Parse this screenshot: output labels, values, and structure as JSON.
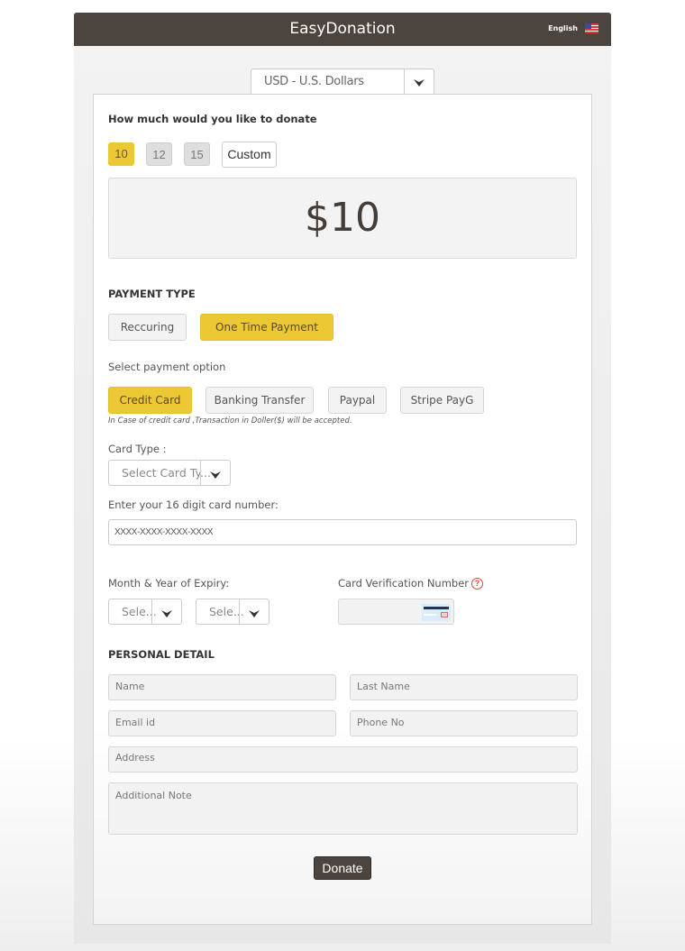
{
  "header": {
    "title": "EasyDonation",
    "language": "English",
    "flag_icon": "us-flag-icon"
  },
  "currency": {
    "selected": "USD - U.S. Dollars"
  },
  "donation": {
    "question": "How much would you like to donate",
    "amounts": [
      {
        "label": "10",
        "selected": true
      },
      {
        "label": "12",
        "selected": false
      },
      {
        "label": "15",
        "selected": false
      }
    ],
    "custom_label": "Custom",
    "display_amount": "$10"
  },
  "payment_type": {
    "heading": "PAYMENT TYPE",
    "options": [
      {
        "label": "Reccuring",
        "selected": false
      },
      {
        "label": "One Time Payment",
        "selected": true
      }
    ]
  },
  "payment_option": {
    "label": "Select payment option",
    "options": [
      {
        "label": "Credit Card",
        "selected": true
      },
      {
        "label": "Banking Transfer",
        "selected": false
      },
      {
        "label": "Paypal",
        "selected": false
      },
      {
        "label": "Stripe PayG",
        "selected": false
      }
    ],
    "note": "In Case of credit card ,Transaction in Doller($) will be accepted."
  },
  "card": {
    "type_label": "Card Type :",
    "type_placeholder": "Select Card Ty...",
    "number_label": "Enter your 16 digit card number:",
    "number_placeholder": "XXXX-XXXX-XXXX-XXXX",
    "expiry_label": "Month & Year of Expiry:",
    "month_placeholder": "Sele...",
    "year_placeholder": "Sele...",
    "cvv_label": "Card Verification Number",
    "cvv_help": "?"
  },
  "personal": {
    "heading": "PERSONAL DETAIL",
    "name_placeholder": "Name",
    "last_name_placeholder": "Last Name",
    "email_placeholder": "Email id",
    "phone_placeholder": "Phone No",
    "address_placeholder": "Address",
    "note_placeholder": "Additional Note"
  },
  "submit": {
    "label": "Donate"
  },
  "colors": {
    "header_bg": "#4c443e",
    "accent": "#ecc834",
    "help": "#e04a3a"
  }
}
